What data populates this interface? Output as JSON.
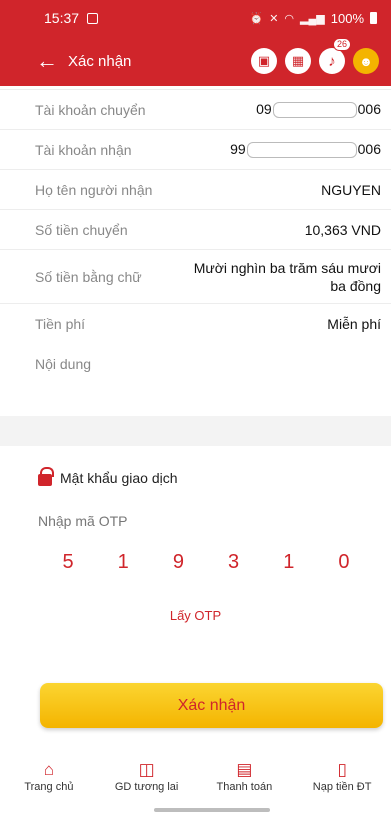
{
  "status_bar": {
    "time": "15:37",
    "battery": "100%"
  },
  "header": {
    "title": "Xác nhận",
    "notification_count": "26"
  },
  "details": {
    "from_label": "Tài khoản chuyển",
    "from_prefix": "09",
    "from_suffix": "006",
    "to_label": "Tài khoản nhận",
    "to_prefix": "99",
    "to_suffix": "006",
    "recipient_label": "Họ tên người nhận",
    "recipient_value": "NGUYEN",
    "amount_label": "Số tiền chuyển",
    "amount_value": "10,363 VND",
    "amount_words_label": "Số tiền bằng chữ",
    "amount_words_value": "Mười nghìn ba trăm sáu mươi ba đồng",
    "fee_label": "Tiền phí",
    "fee_value": "Miễn phí",
    "content_label": "Nội dung",
    "content_value": ""
  },
  "otp": {
    "password_label": "Mật khẩu giao dịch",
    "input_label": "Nhập mã OTP",
    "digits": [
      "5",
      "1",
      "9",
      "3",
      "1",
      "0"
    ],
    "get_otp_label": "Lấy OTP"
  },
  "confirm_label": "Xác nhận",
  "nav": {
    "home": "Trang chủ",
    "future": "GD tương lai",
    "payment": "Thanh toán",
    "topup": "Nạp tiền ĐT"
  },
  "colors": {
    "brand_red": "#d0252b",
    "button_yellow": "#f4b400"
  }
}
